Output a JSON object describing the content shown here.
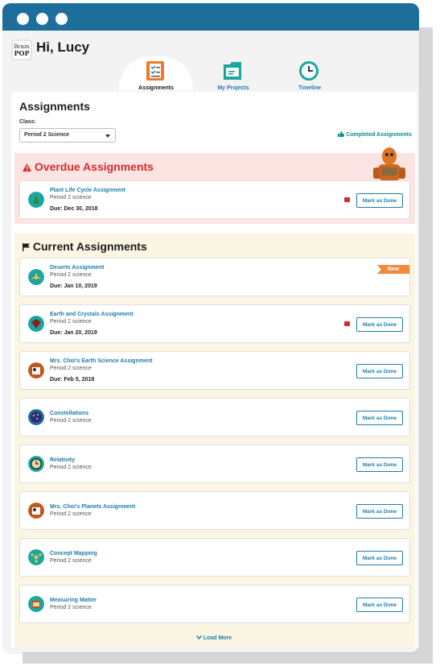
{
  "header": {
    "greeting": "Hi, Lucy",
    "logo_text": "Brain POP"
  },
  "tabs": [
    {
      "label": "Assignments",
      "active": true,
      "color": "#1a1a1a"
    },
    {
      "label": "My Projects",
      "active": false,
      "color": "#1d7eaa"
    },
    {
      "label": "Timeline",
      "active": false,
      "color": "#1d7eaa"
    }
  ],
  "main": {
    "title": "Assignments",
    "class_label": "Class:",
    "class_value": "Period 2 Science",
    "completed_link": "Completed Assignments",
    "overdue_title": "Overdue Assignments",
    "current_title": "Current Assignments",
    "load_more": "Load More",
    "mark_label": "Mark as Done",
    "new_label": "New"
  },
  "overdue": [
    {
      "name": "Plant Life Cycle Assignment",
      "class": "Period 2 science",
      "due": "Due: Dec 30, 2018",
      "comment": true,
      "icon": "plant-icon"
    }
  ],
  "current": [
    {
      "name": "Deserts Assignment",
      "class": "Period 2 science",
      "due": "Due: Jan 10, 2019",
      "is_new": true,
      "icon": "desert-icon"
    },
    {
      "name": "Earth and Crystals Assignment",
      "class": "Period 2 science",
      "due": "Due: Jan 20, 2019",
      "comment": true,
      "icon": "crystal-icon"
    },
    {
      "name": "Mrs. Choi's Earth Science Assignment",
      "class": "Period 2 science",
      "due": "Due: Feb 5, 2018",
      "icon": "teacher-icon"
    },
    {
      "name": "Constellations",
      "class": "Period 2 science",
      "icon": "constellation-icon"
    },
    {
      "name": "Relativity",
      "class": "Period 2 science",
      "icon": "clock-icon"
    },
    {
      "name": "Mrs. Choi's Planets Assignment",
      "class": "Period 2 science",
      "icon": "teacher-icon"
    },
    {
      "name": "Concept Mapping",
      "class": "Period 2 science",
      "icon": "concept-map-icon"
    },
    {
      "name": "Measuring Matter",
      "class": "Period 2 science",
      "icon": "beaker-icon"
    }
  ],
  "colors": {
    "accent": "#1d7eaa",
    "overdue_bg": "#fbe4e2",
    "overdue_text": "#d62b2b",
    "current_bg": "#fbf6e3",
    "titlebar": "#1d6e9b",
    "new_badge": "#f08a3c"
  }
}
